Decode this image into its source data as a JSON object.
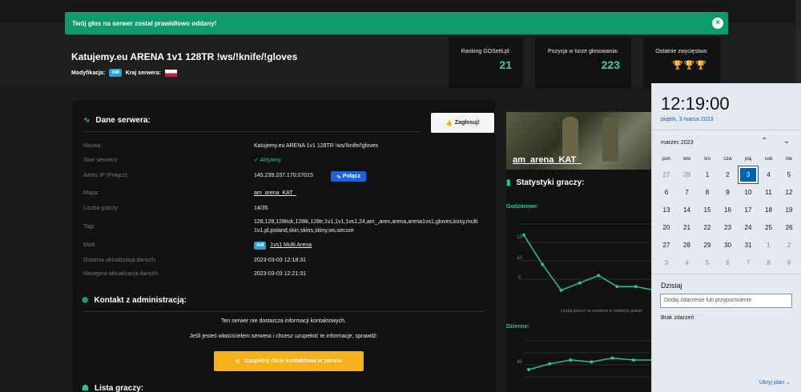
{
  "toast": {
    "message": "Twój głos na serwer został prawidłowo oddany!",
    "close_icon": "close-icon"
  },
  "server": {
    "title": "Katujemy.eu ARENA 1v1 128TR !ws/!knife/!gloves",
    "mod_label": "Modyfikacja:",
    "mod_badge": "AM",
    "country_label": "Kraj serwera:"
  },
  "stats": [
    {
      "label": "Ranking GOSetti.pl:",
      "value": "21"
    },
    {
      "label": "Pozycja w turze głosowania:",
      "value": "223"
    },
    {
      "label": "Ostatnie zwycięstwa:",
      "value": ""
    }
  ],
  "panel": {
    "section_title": "Dane serwera:",
    "vote_label": "Zagłosuj!",
    "rows": [
      {
        "label": "Nazwa:",
        "value": "Katujemy.eu ARENA 1v1 128TR !ws/!knife/!gloves"
      },
      {
        "label": "Stan serwera:",
        "value": "Aktywny"
      },
      {
        "label": "Adres IP (Połącz):",
        "value": "145.239.237.170:27015"
      },
      {
        "label": "Mapa:",
        "value": "am_arena_KAT_"
      },
      {
        "label": "Liczba graczy:",
        "value": "14/35"
      },
      {
        "label": "Tagi:",
        "value": "128,128,128tick,128tk,128tr,1v1,1v1,1vs1,24,am_,aren,arena,arena1vs1,gloves,kosy,multi 1v1,pl,poland,skin,skins,skiny,ws,secure"
      },
      {
        "label": "Mod:",
        "value": "1vs1 Multi Arena",
        "badge": "AM"
      },
      {
        "label": "Ostatnia aktualizacja danych:",
        "value": "2023-03-03 12:18:31"
      },
      {
        "label": "Następna aktualizacja danych:",
        "value": "2023-03-03 12:21:31"
      }
    ],
    "connect_label": "Połącz",
    "contact_title": "Kontakt z administracją:",
    "contact_info": "Ten serwer nie dostarcza informacji kontaktowych.",
    "contact_owner": "Jeśli jesteś właścicielem serwera i chcesz uzupełnić te informacje, sprawdź:",
    "contact_button": "Uzupełnij dane kontaktowe w panelu",
    "players_title": "Lista graczy:"
  },
  "right": {
    "map_name": "am_arena_KAT_",
    "stats_title": "Statystyki graczy:",
    "hourly_label": "Godzinowe:",
    "daily_label": "Dzienne:",
    "hourly_ticks": [
      "15",
      "10",
      "5"
    ],
    "daily_ticks": [
      "30"
    ],
    "hourly_caption": "Liczba graczy na serwerze w ostatnich godzin"
  },
  "chart_data": [
    {
      "type": "line",
      "title": "Godzinowe:",
      "xlabel": "Liczba graczy na serwerze w ostatnich godzin",
      "ylabel": "",
      "ylim": [
        0,
        20
      ],
      "series": [
        {
          "values": [
            17,
            9,
            2,
            4,
            6,
            3,
            3,
            2
          ]
        }
      ]
    },
    {
      "type": "line",
      "title": "Dzienne:",
      "series": [
        {
          "values": [
            30,
            33,
            35,
            34,
            36,
            35,
            35
          ]
        }
      ]
    }
  ],
  "calendar": {
    "time": "12:19:00",
    "date": "piątek, 3 marca 2023",
    "month": "marzec 2023",
    "weekdays": [
      "pon",
      "wto",
      "śro",
      "czw",
      "pią",
      "sob",
      "nie"
    ],
    "weeks": [
      [
        "27",
        "28",
        "1",
        "2",
        "3",
        "4",
        "5"
      ],
      [
        "6",
        "7",
        "8",
        "9",
        "10",
        "11",
        "12"
      ],
      [
        "13",
        "14",
        "15",
        "16",
        "17",
        "18",
        "19"
      ],
      [
        "20",
        "21",
        "22",
        "23",
        "24",
        "25",
        "26"
      ],
      [
        "27",
        "28",
        "29",
        "30",
        "31",
        "1",
        "2"
      ],
      [
        "3",
        "4",
        "5",
        "6",
        "7",
        "8",
        "9"
      ]
    ],
    "today_label": "Dzisiaj",
    "event_placeholder": "Dodaj zdarzenie lub przypomnienie",
    "no_events": "Brak zdarzeń",
    "hide_plan": "Ukryj plan"
  },
  "colors": {
    "accent": "#22c594",
    "toast_bg": "#0d9a6c",
    "connect": "#1e63d6",
    "panel_button": "#f6b01e",
    "calendar_today": "#0063b1"
  }
}
